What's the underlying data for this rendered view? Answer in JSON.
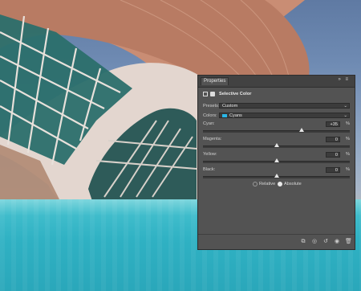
{
  "panel": {
    "tab_label": "Properties",
    "menu_icons": "»  ≡",
    "section_title": "Selective Color",
    "presets_label": "Presets:",
    "preset_value": "Custom",
    "colors_label": "Colors:",
    "color_value": "Cyans",
    "accent_color": "#29b6e6",
    "sliders": [
      {
        "label": "Cyan:",
        "value": "+35",
        "percent": "%",
        "level": 0.67
      },
      {
        "label": "Magenta:",
        "value": "0",
        "percent": "%",
        "level": 0.5
      },
      {
        "label": "Yellow:",
        "value": "0",
        "percent": "%",
        "level": 0.5
      },
      {
        "label": "Black:",
        "value": "0",
        "percent": "%",
        "level": 0.5
      }
    ],
    "method": {
      "relative_label": "Relative",
      "absolute_label": "Absolute",
      "selected": "Absolute"
    },
    "footer_icons": [
      "clip-to-layer-icon",
      "view-previous-icon",
      "reset-icon",
      "visibility-eye-icon",
      "delete-trash-icon"
    ]
  }
}
